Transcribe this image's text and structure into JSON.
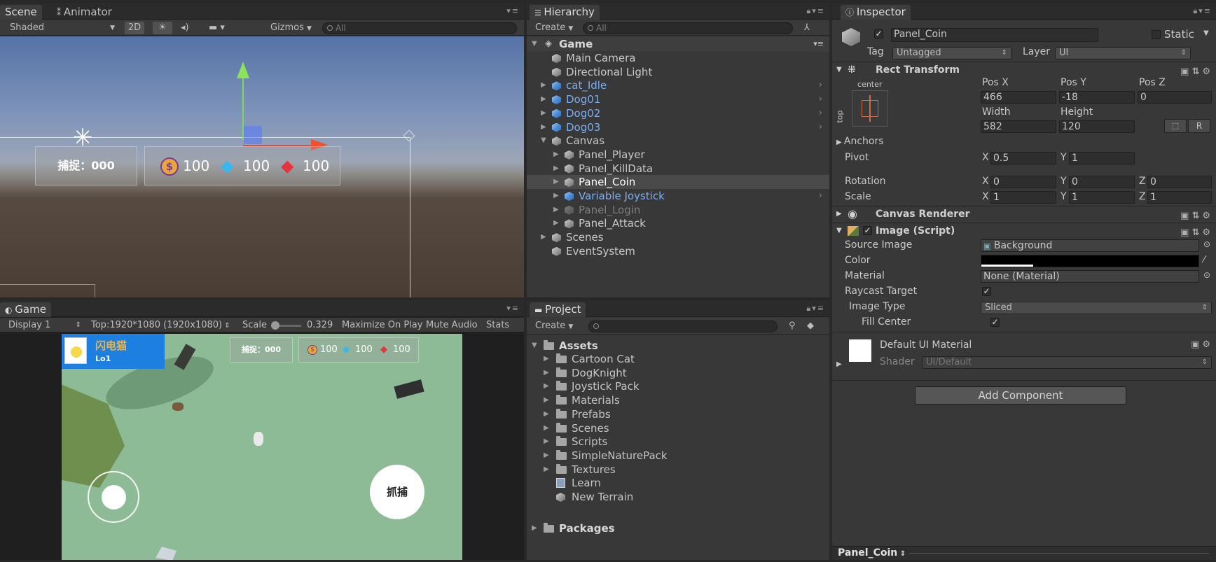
{
  "scene_panel": {
    "tab_scene": "Scene",
    "tab_animator": "Animator",
    "shading": "Shaded",
    "btn_2d": "2D",
    "gizmos": "Gizmos",
    "search_placeholder": "All",
    "hud": {
      "capture": "捕捉：000",
      "coin": "100",
      "diamond": "100",
      "ruby": "100"
    }
  },
  "game_panel": {
    "tab": "Game",
    "display": "Display 1",
    "resolution": "Top:1920*1080 (1920x1080)",
    "scale_label": "Scale",
    "scale_value": "0.329",
    "maximize": "Maximize On Play",
    "mute": "Mute Audio",
    "stats": "Stats",
    "player_name": "闪电猫",
    "player_level": "Lo1",
    "capture": "捕捉：000",
    "coin": "100",
    "diamond": "100",
    "ruby": "100",
    "catch_button": "抓捕"
  },
  "hierarchy": {
    "tab": "Hierarchy",
    "create": "Create",
    "search_placeholder": "All",
    "root": "Game",
    "items": [
      {
        "label": "Main Camera",
        "color": "#c8c8c8"
      },
      {
        "label": "Directional Light",
        "color": "#c8c8c8"
      },
      {
        "label": "cat_Idle",
        "color": "#7aaef0"
      },
      {
        "label": "Dog01",
        "color": "#7aaef0"
      },
      {
        "label": "Dog02",
        "color": "#7aaef0"
      },
      {
        "label": "Dog03",
        "color": "#7aaef0"
      },
      {
        "label": "Canvas",
        "color": "#c8c8c8"
      },
      {
        "label": "Panel_Player",
        "color": "#c8c8c8"
      },
      {
        "label": "Panel_KillData",
        "color": "#c8c8c8"
      },
      {
        "label": "Panel_Coin",
        "color": "#ffffff"
      },
      {
        "label": "Variable Joystick",
        "color": "#7aaef0"
      },
      {
        "label": "Panel_Login",
        "color": "#7d7d7d"
      },
      {
        "label": "Panel_Attack",
        "color": "#c8c8c8"
      },
      {
        "label": "Scenes",
        "color": "#c8c8c8"
      },
      {
        "label": "EventSystem",
        "color": "#c8c8c8"
      }
    ]
  },
  "project": {
    "tab": "Project",
    "create": "Create",
    "assets": "Assets",
    "packages": "Packages",
    "items": [
      "Cartoon Cat",
      "DogKnight",
      "Joystick Pack",
      "Materials",
      "Prefabs",
      "Scenes",
      "Scripts",
      "SimpleNaturePack",
      "Textures",
      "Learn",
      "New Terrain"
    ]
  },
  "inspector": {
    "tab": "Inspector",
    "object_name": "Panel_Coin",
    "static_label": "Static",
    "tag_label": "Tag",
    "tag_value": "Untagged",
    "layer_label": "Layer",
    "layer_value": "UI",
    "rect_transform": {
      "title": "Rect Transform",
      "anchor_preset_top": "center",
      "anchor_preset_side": "top",
      "pos_x_label": "Pos X",
      "pos_y_label": "Pos Y",
      "pos_z_label": "Pos Z",
      "pos_x": "466",
      "pos_y": "-18",
      "pos_z": "0",
      "width_label": "Width",
      "height_label": "Height",
      "width": "582",
      "height": "120",
      "r_button": "R",
      "anchors": "Anchors",
      "pivot": "Pivot",
      "pivot_x": "0.5",
      "pivot_y": "1",
      "rotation": "Rotation",
      "rot_x": "0",
      "rot_y": "0",
      "rot_z": "0",
      "scale": "Scale",
      "scale_x": "1",
      "scale_y": "1",
      "scale_z": "1",
      "x": "X",
      "y": "Y",
      "z": "Z"
    },
    "canvas_renderer": "Canvas Renderer",
    "image": {
      "title": "Image (Script)",
      "source_image_label": "Source Image",
      "source_image": "Background",
      "color_label": "Color",
      "material_label": "Material",
      "material": "None (Material)",
      "raycast_label": "Raycast Target",
      "image_type_label": "Image Type",
      "image_type": "Sliced",
      "fill_center_label": "Fill Center"
    },
    "material": {
      "name": "Default UI Material",
      "shader_label": "Shader",
      "shader": "UI/Default"
    },
    "add_component": "Add Component",
    "footer": "Panel_Coin"
  }
}
